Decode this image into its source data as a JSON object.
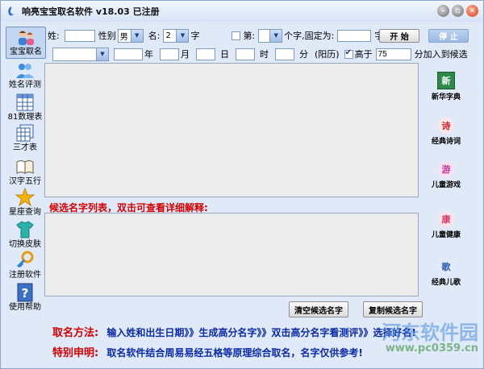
{
  "window": {
    "title": "响亮宝宝取名软件 v18.03 已注册"
  },
  "sidebar": {
    "items": [
      {
        "label": "宝宝取名",
        "icon": "family-icon"
      },
      {
        "label": "姓名评测",
        "icon": "people-icon"
      },
      {
        "label": "81数理表",
        "icon": "grid-table-icon"
      },
      {
        "label": "三才表",
        "icon": "table-stack-icon"
      },
      {
        "label": "汉字五行",
        "icon": "book-icon"
      },
      {
        "label": "星座查询",
        "icon": "star-icon"
      },
      {
        "label": "切换皮肤",
        "icon": "shirt-icon"
      },
      {
        "label": "注册软件",
        "icon": "key-icon"
      },
      {
        "label": "使用帮助",
        "icon": "help-icon"
      }
    ]
  },
  "form": {
    "surname_label": "姓:",
    "surname_value": "",
    "gender_label": "性别",
    "gender_value": "男",
    "name_label": "名:",
    "name_count_value": "2",
    "name_count_unit": "字",
    "fixed_label": "第:",
    "fixed_pos_value": "",
    "fixed_mid": "个字,固定为:",
    "fixed_value": "",
    "fixed_unit": "字",
    "start_button": "开 始",
    "stop_button": "停 止",
    "calendar_value": "",
    "year_value": "",
    "year_label": "年",
    "month_value": "",
    "month_label": "月",
    "day_value": "",
    "day_label": "日",
    "hour_value": "",
    "hour_label": "时",
    "minute_value": "",
    "minute_label": "分",
    "calendar_type": "(阳历)",
    "above_label": "高于",
    "above_value": "75",
    "above_suffix": "分加入到候选"
  },
  "candidates": {
    "heading": "候选名字列表，双击可查看详细解释:",
    "clear_button": "清空候选名字",
    "copy_button": "复制候选名字"
  },
  "right_tools": [
    {
      "glyph": "新",
      "label": "新华字典",
      "color": "#1a7a3a"
    },
    {
      "glyph": "诗",
      "label": "经典诗词",
      "color": "#c8202a"
    },
    {
      "glyph": "游",
      "label": "儿童游戏",
      "color": "#c83a9a"
    },
    {
      "glyph": "康",
      "label": "儿童健康",
      "color": "#d83a6a"
    },
    {
      "glyph": "歌",
      "label": "经典儿歌",
      "color": "#2a5ab8"
    }
  ],
  "footer": {
    "method_label": "取名方法:",
    "method_text": "输入姓和出生日期》》生成高分名字》》双击高分名字看测评》》选择好名!",
    "note_label": "特别申明:",
    "note_text": "取名软件结合周易易经五格等原理综合取名，名字仅供参考!"
  },
  "watermark": {
    "line1": "河东软件园",
    "line2": "www.pc0359.cn"
  },
  "colors": {
    "accent_red": "#d40000",
    "accent_blue": "#0a2aa8",
    "window_bg": "#dfe9f8"
  }
}
